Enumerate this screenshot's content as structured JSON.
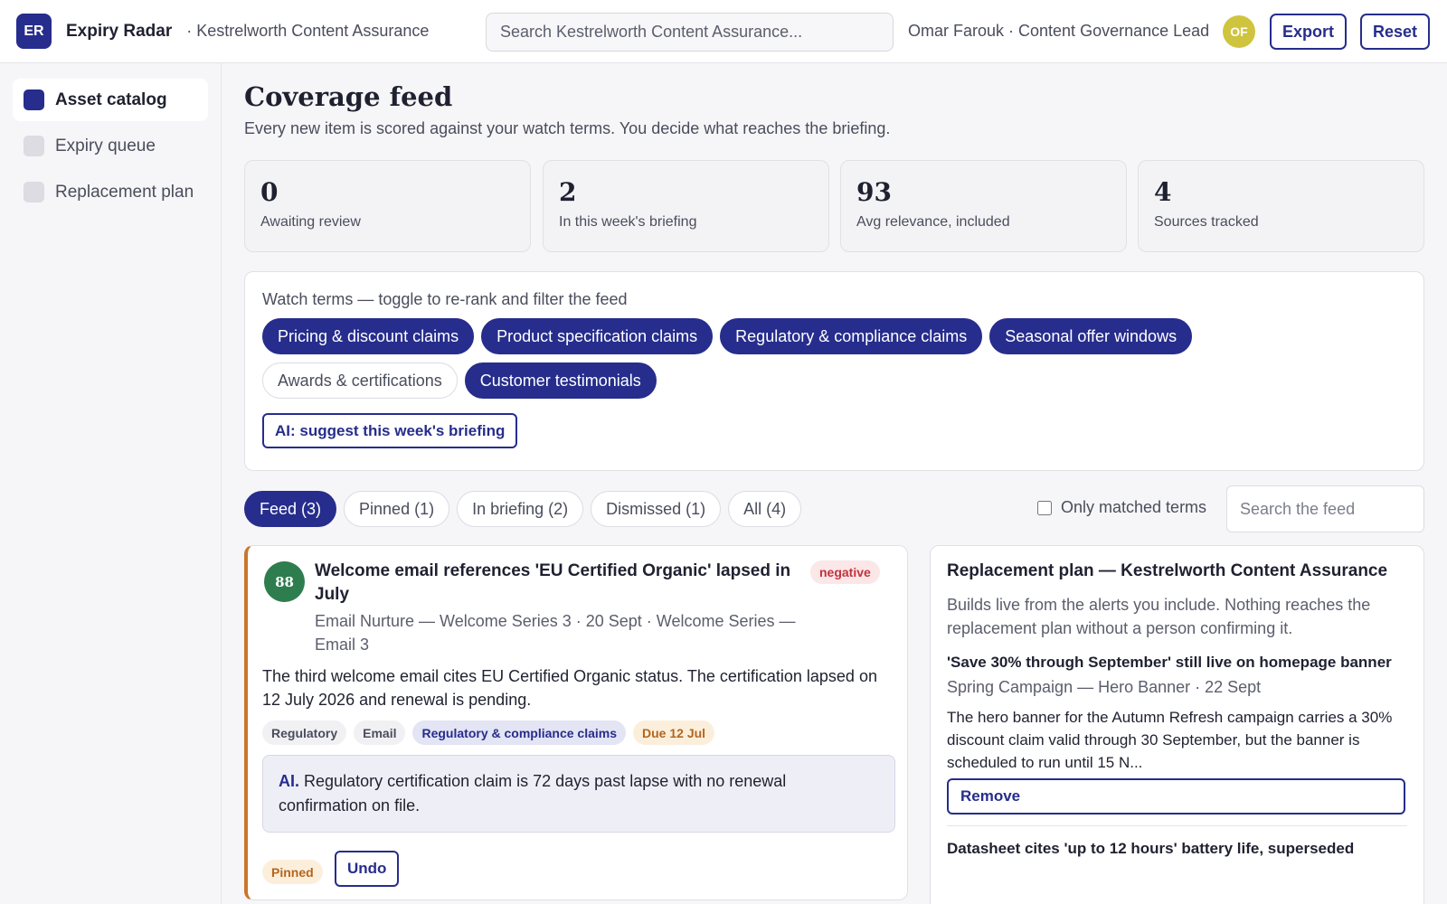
{
  "header": {
    "logo_initials": "ER",
    "app_name": "Expiry Radar",
    "org_name": "· Kestrelworth Content Assurance",
    "search_placeholder": "Search Kestrelworth Content Assurance...",
    "user_label": "Omar Farouk · Content Governance Lead",
    "avatar_initials": "OF",
    "export_label": "Export",
    "reset_label": "Reset"
  },
  "sidebar": {
    "items": [
      {
        "label": "Asset catalog",
        "active": true
      },
      {
        "label": "Expiry queue",
        "active": false
      },
      {
        "label": "Replacement plan",
        "active": false
      }
    ]
  },
  "main": {
    "title": "Coverage feed",
    "subtitle": "Every new item is scored against your watch terms. You decide what reaches the briefing.",
    "stats": [
      {
        "value": "0",
        "label": "Awaiting review"
      },
      {
        "value": "2",
        "label": "In this week's briefing"
      },
      {
        "value": "93",
        "label": "Avg relevance, included"
      },
      {
        "value": "4",
        "label": "Sources tracked"
      }
    ],
    "watch_terms": {
      "title": "Watch terms — toggle to re-rank and filter the feed",
      "chips": [
        {
          "label": "Pricing & discount claims",
          "on": true
        },
        {
          "label": "Product specification claims",
          "on": true
        },
        {
          "label": "Regulatory & compliance claims",
          "on": true
        },
        {
          "label": "Seasonal offer windows",
          "on": true
        },
        {
          "label": "Awards & certifications",
          "on": false
        },
        {
          "label": "Customer testimonials",
          "on": true
        }
      ],
      "ai_button": "AI: suggest this week's briefing"
    },
    "tabs": [
      {
        "label": "Feed (3)",
        "on": true
      },
      {
        "label": "Pinned (1)",
        "on": false
      },
      {
        "label": "In briefing (2)",
        "on": false
      },
      {
        "label": "Dismissed (1)",
        "on": false
      },
      {
        "label": "All (4)",
        "on": false
      }
    ],
    "only_matched_label": "Only matched terms",
    "feed_search_placeholder": "Search the feed"
  },
  "feed_card": {
    "score": "88",
    "title": "Welcome email references 'EU Certified Organic' lapsed in July",
    "sentiment": "negative",
    "meta": "Email Nurture — Welcome Series 3 · 20 Sept · Welcome Series — Email 3",
    "body": "The third welcome email cites EU Certified Organic status. The certification lapsed on 12 July 2026 and renewal is pending.",
    "tags": {
      "category": "Regulatory",
      "channel": "Email",
      "term": "Regulatory & compliance claims",
      "due": "Due 12 Jul"
    },
    "ai_prefix": "AI.",
    "ai_text": "Regulatory certification claim is 72 days past lapse with no renewal confirmation on file.",
    "pinned_label": "Pinned",
    "undo_label": "Undo"
  },
  "plan": {
    "title": "Replacement plan — Kestrelworth Content Assurance",
    "subtitle": "Builds live from the alerts you include. Nothing reaches the replacement plan without a person confirming it.",
    "items": [
      {
        "title": "'Save 30% through September' still live on homepage banner",
        "meta": "Spring Campaign — Hero Banner · 22 Sept",
        "body": "The hero banner for the Autumn Refresh campaign carries a 30% discount claim valid through 30 September, but the banner is scheduled to run until 15 N...",
        "remove_label": "Remove"
      },
      {
        "title": "Datasheet cites 'up to 12 hours' battery life, superseded"
      }
    ]
  },
  "colors": {
    "accent": "#262d8c",
    "score_green": "#2e7d4f",
    "card_border": "#c9762a",
    "negative": "#c2333d",
    "avatar": "#cfc43e"
  }
}
